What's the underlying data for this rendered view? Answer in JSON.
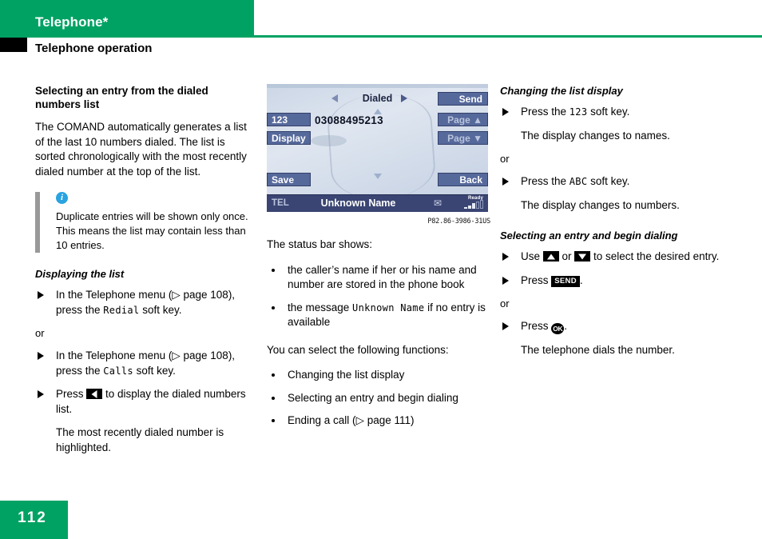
{
  "header": {
    "chapter_title": "Telephone*",
    "section_title": "Telephone operation"
  },
  "footer": {
    "page_number": "112"
  },
  "left_column": {
    "heading": "Selecting an entry from the dialed numbers list",
    "intro": "The COMAND automatically generates a list of the last 10 numbers dialed. The list is sorted chronologically with the most recently dialed number at the top of the list.",
    "note": {
      "icon": "info-icon",
      "text": "Duplicate entries will be shown only once. This means the list may contain less than 10 entries."
    },
    "subheading": "Displaying the list",
    "step1_pre": "In the Telephone menu (",
    "step1_ref": "▷ page 108",
    "step1_mid": "), press the ",
    "step1_key": "Redial",
    "step1_post": " soft key.",
    "or": "or",
    "step2_pre": "In the Telephone menu (",
    "step2_ref": "▷ page 108",
    "step2_mid": "), press the ",
    "step2_key": "Calls",
    "step2_post": " soft key.",
    "step3_pre": "Press ",
    "step3_key": "left-arrow-key",
    "step3_post": " to display the dialed numbers list.",
    "step3_result": "The most recently dialed number is highlighted."
  },
  "comand_display": {
    "title": "Dialed",
    "left_arrow": "prev-arrow-icon",
    "right_arrow": "next-arrow-icon",
    "scroll_up": "scroll-up-icon",
    "scroll_down": "scroll-down-icon",
    "number": "03088495213",
    "softkeys": {
      "send": "Send",
      "page_up": "Page ▲",
      "page_down": "Page ▼",
      "back": "Back",
      "mode_123": "123",
      "display": "Display",
      "save": "Save"
    },
    "status_bar": {
      "mode": "TEL",
      "caller": "Unknown Name",
      "mail_icon": "envelope-icon",
      "signal_label": "Ready",
      "signal_bars": 3
    },
    "figure_caption": "P82.86-3986-31US"
  },
  "middle_column": {
    "status_bar_intro": "The status bar shows:",
    "bullets": [
      "the caller’s name if her or his name and number are stored in the phone book"
    ],
    "bullet2_pre": "the message ",
    "bullet2_key": "Unknown Name",
    "bullet2_post": " if no entry is available",
    "functions_intro": "You can select the following functions:",
    "functions": [
      "Changing the list display",
      "Selecting an entry and begin dialing"
    ],
    "function3_pre": "Ending a call (",
    "function3_ref": "▷ page 111",
    "function3_post": ")"
  },
  "right_column": {
    "heading1": "Changing the list display",
    "r1_pre": "Press the ",
    "r1_key": "123",
    "r1_post": " soft key.",
    "r1_result": "The display changes to names.",
    "or": "or",
    "r2_pre": "Press the ",
    "r2_key": "ABC",
    "r2_post": " soft key.",
    "r2_result": "The display changes to numbers.",
    "heading2": "Selecting an entry and begin dialing",
    "r3_pre": "Use ",
    "r3_key_up": "up-arrow-key",
    "r3_mid": " or ",
    "r3_key_down": "down-arrow-key",
    "r3_post": " to select the desired entry.",
    "r4_pre": "Press ",
    "r4_key": "SEND",
    "r4_post": ".",
    "r5_pre": "Press ",
    "r5_key": "OK",
    "r5_post": ".",
    "r5_result": "The telephone dials the number."
  },
  "colors": {
    "brand_green": "#00a263",
    "info_blue": "#2aa3e0",
    "softkey_blue": "#56699b",
    "status_bar_blue": "#3a4573"
  }
}
